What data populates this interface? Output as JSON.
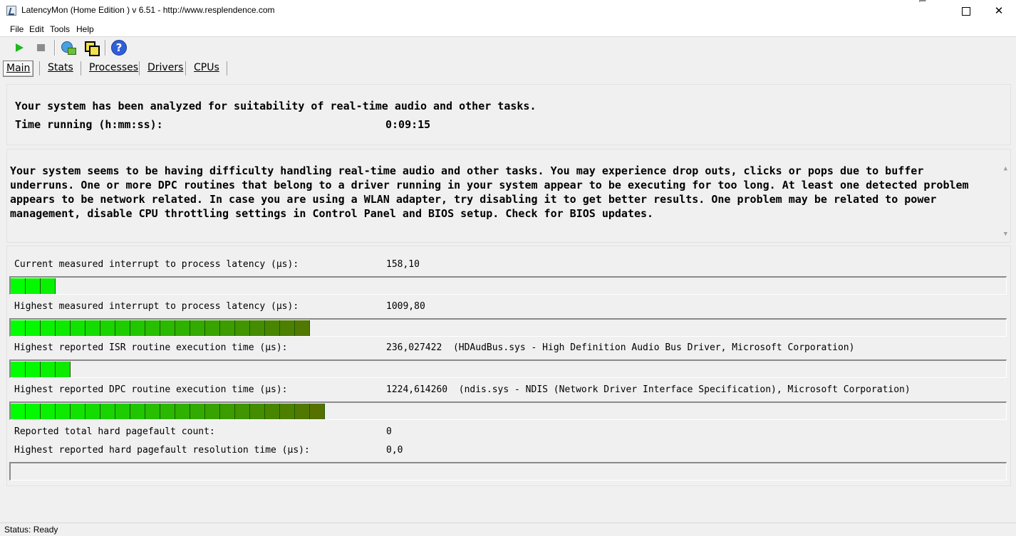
{
  "window": {
    "title": "LatencyMon  (Home Edition )  v 6.51 - http://www.resplendence.com",
    "minimize_icon": "minimize-icon",
    "maximize_icon": "maximize-icon",
    "close_icon": "close-icon"
  },
  "menu": {
    "items": [
      "File",
      "Edit",
      "Tools",
      "Help"
    ]
  },
  "toolbar": {
    "icons": [
      "play-icon",
      "stop-icon",
      "scan-drivers-icon",
      "windows-icon",
      "help-icon"
    ],
    "colors": {
      "play": "#1fb81f",
      "help": "#2f5fd8"
    }
  },
  "tabs": [
    "Main",
    "Stats",
    "Processes",
    "Drivers",
    "CPUs"
  ],
  "summary": {
    "analyzed": "Your system has been analyzed for suitability of real-time audio and other tasks.",
    "time_label": "Time running (h:mm:ss):",
    "time_value": "0:09:15"
  },
  "message": "Your system seems to be having difficulty handling real-time audio and other tasks. You may experience drop outs, clicks or pops due to buffer underruns. One or more DPC routines that belong to a driver running in your system appear to be executing for too long. At least one detected problem appears to be network related. In case you are using a WLAN adapter, try disabling it to get better results. One problem may be related to power management, disable CPU throttling settings in Control Panel and BIOS setup. Check for BIOS updates.",
  "metrics": {
    "current_latency": {
      "label": "Current measured interrupt to process latency (µs):",
      "value": "158,10",
      "segments": 3
    },
    "highest_latency": {
      "label": "Highest measured interrupt to process latency (µs):",
      "value": "1009,80",
      "segments": 20
    },
    "isr": {
      "label": "Highest reported ISR routine execution time (µs):",
      "value": "236,027422",
      "driver": "(HDAudBus.sys - High Definition Audio Bus Driver, Microsoft Corporation)",
      "segments": 4
    },
    "dpc": {
      "label": "Highest reported DPC routine execution time (µs):",
      "value": "1224,614260",
      "driver": "(ndis.sys - NDIS (Network Driver Interface Specification), Microsoft Corporation)",
      "segments": 21
    },
    "pagefault_count": {
      "label": "Reported total hard pagefault count:",
      "value": "0"
    },
    "pagefault_time": {
      "label": "Highest reported hard pagefault resolution time (µs):",
      "value": "0,0",
      "segments": 0
    }
  },
  "bar_colors": {
    "start": "#00ff00",
    "end": "#5a6a00"
  },
  "status": "Status: Ready"
}
